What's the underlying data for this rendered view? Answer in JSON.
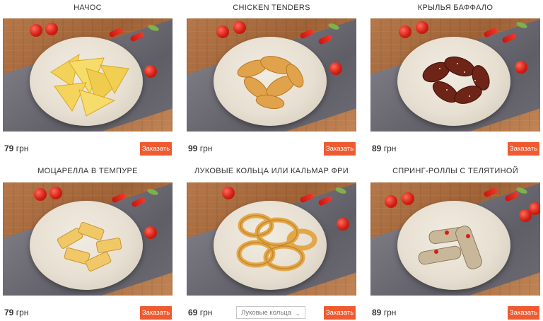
{
  "products": [
    {
      "title": "НАЧОС",
      "price": "79",
      "currency": "грн",
      "button": "Заказать"
    },
    {
      "title": "CHICKEN TENDERS",
      "price": "99",
      "currency": "грн",
      "button": "Заказать"
    },
    {
      "title": "КРЫЛЬЯ БАФФАЛО",
      "price": "89",
      "currency": "грн",
      "button": "Заказать"
    },
    {
      "title": "МОЦАРЕЛЛА В ТЕМПУРЕ",
      "price": "79",
      "currency": "грн",
      "button": "Заказать"
    },
    {
      "title": "ЛУКОВЫЕ КОЛЬЦА ИЛИ КАЛЬМАР ФРИ",
      "price": "69",
      "currency": "грн",
      "button": "Заказать",
      "option_selected": "Луковые кольца"
    },
    {
      "title": "СПРИНГ-РОЛЛЫ С ТЕЛЯТИНОЙ",
      "price": "89",
      "currency": "грн",
      "button": "Заказать"
    }
  ],
  "colors": {
    "button": "#ef5a30",
    "text": "#333333"
  }
}
